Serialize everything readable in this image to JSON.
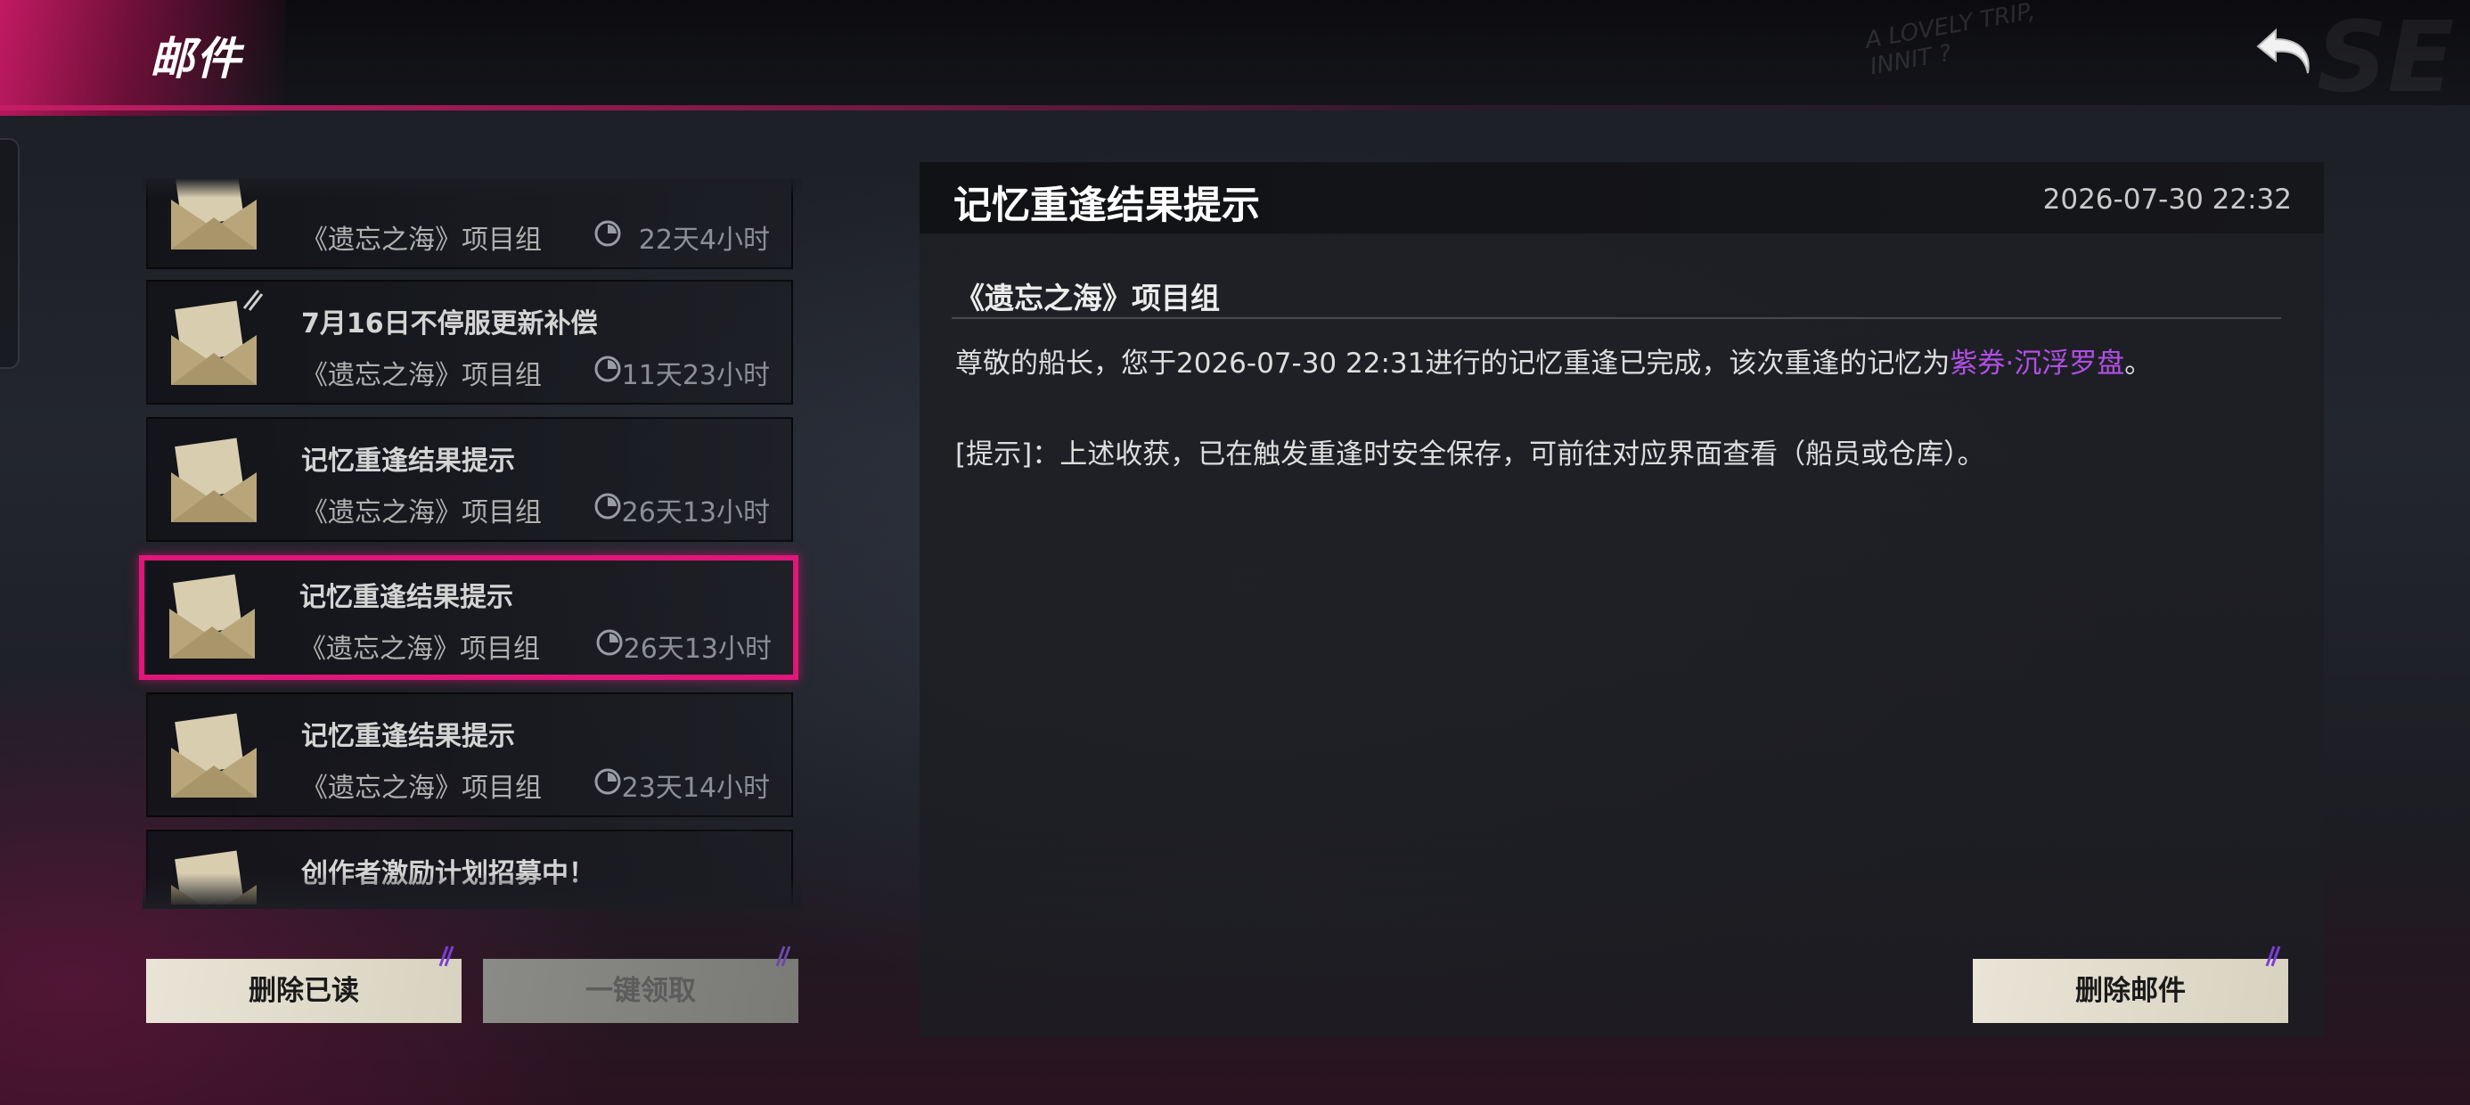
{
  "header": {
    "title": "邮件",
    "bg_scribble_line1": "A LOVELY TRIP,",
    "bg_scribble_line2": "INNIT ?",
    "bg_logo": "SE",
    "back_icon": "back-arrow-icon"
  },
  "mail_list": [
    {
      "title": "",
      "sender": "《遗忘之海》项目组",
      "expiry": "22天4小时",
      "attachment": false
    },
    {
      "title": "7月16日不停服更新补偿",
      "sender": "《遗忘之海》项目组",
      "expiry": "11天23小时",
      "attachment": true
    },
    {
      "title": "记忆重逢结果提示",
      "sender": "《遗忘之海》项目组",
      "expiry": "26天13小时",
      "attachment": false
    },
    {
      "title": "记忆重逢结果提示",
      "sender": "《遗忘之海》项目组",
      "expiry": "26天13小时",
      "attachment": false,
      "selected": true
    },
    {
      "title": "记忆重逢结果提示",
      "sender": "《遗忘之海》项目组",
      "expiry": "23天14小时",
      "attachment": false
    },
    {
      "title": "创作者激励计划招募中！",
      "sender": "",
      "expiry": "",
      "attachment": false
    }
  ],
  "buttons": {
    "delete_read": "删除已读",
    "claim_all": "一键领取",
    "delete_mail": "删除邮件"
  },
  "detail": {
    "title": "记忆重逢结果提示",
    "date": "2026-07-30 22:32",
    "sender": "《遗忘之海》项目组",
    "body_prefix": "尊敬的船长，您于2026-07-30 22:31进行的记忆重逢已完成，该次重逢的记忆为",
    "body_highlight": "紫券·沉浮罗盘",
    "body_suffix": "。",
    "hint": "[提示]：上述收获，已在触发重逢时安全保存，可前往对应界面查看（船员或仓库）。"
  },
  "colors": {
    "accent": "#e0167a",
    "highlight": "#b04fe6",
    "button_bg": "#e9e4d6"
  }
}
